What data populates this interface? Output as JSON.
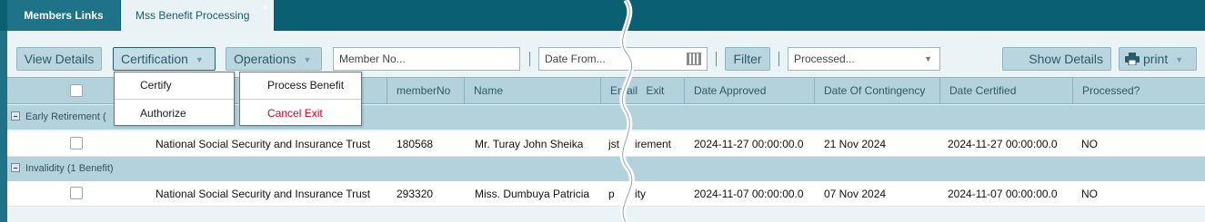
{
  "tabs": [
    {
      "label": "Members Links",
      "active": false
    },
    {
      "label": "Mss Benefit Processing",
      "active": true
    }
  ],
  "tab_close_glyph": "×",
  "toolbar": {
    "view_details": "View Details",
    "certification": "Certification",
    "operations": "Operations",
    "member_no_placeholder": "Member No...",
    "date_from_placeholder": "Date From...",
    "filter": "Filter",
    "processed_placeholder": "Processed...",
    "show_details": "Show Details",
    "print": "print"
  },
  "certification_menu": [
    "Certify",
    "Authorize"
  ],
  "operations_menu": [
    "Process Benefit",
    "Cancel Exit"
  ],
  "columns": [
    "",
    "",
    "memberNo",
    "Name",
    "Email",
    "Exit",
    "Date Approved",
    "Date Of Contingency",
    "Date Certified",
    "Processed?"
  ],
  "groups": [
    {
      "label": "Early Retirement (",
      "rows": [
        {
          "scheme": "National Social Security and Insurance Trust",
          "memberNo": "180568",
          "name": "Mr. Turay John Sheika",
          "email": "jst",
          "exit": "irement",
          "date_approved": "2024-11-27 00:00:00.0",
          "date_contingency": "21 Nov 2024",
          "date_certified": "2024-11-27 00:00:00.0",
          "processed": "NO"
        }
      ]
    },
    {
      "label": "Invalidity (1 Benefit)",
      "rows": [
        {
          "scheme": "National Social Security and Insurance Trust",
          "memberNo": "293320",
          "name": "Miss. Dumbuya Patricia",
          "email": "p",
          "exit": "ity",
          "date_approved": "2024-11-07 00:00:00.0",
          "date_contingency": "07 Nov 2024",
          "date_certified": "2024-11-07 00:00:00.0",
          "processed": "NO"
        }
      ]
    }
  ],
  "colors": {
    "tabbar": "#0b5f72",
    "header": "#b3d2dc",
    "cancel_exit": "#d0021b"
  },
  "icons": [
    "close-icon",
    "caret-down-icon",
    "calendar-icon",
    "printer-icon",
    "collapse-icon",
    "checkbox-icon"
  ]
}
